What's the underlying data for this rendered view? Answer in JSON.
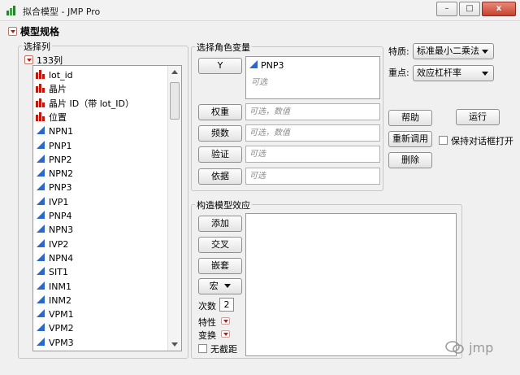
{
  "window": {
    "title": "拟合模型 - JMP Pro",
    "minimize": "–",
    "maximize": "□",
    "close": "x"
  },
  "outline": {
    "title": "模型规格"
  },
  "columns_panel": {
    "label": "选择列",
    "count_label": "133列",
    "items": [
      {
        "label": "lot_id",
        "type": "nominal"
      },
      {
        "label": "晶片",
        "type": "nominal"
      },
      {
        "label": "晶片 ID（带 lot_ID）",
        "type": "nominal"
      },
      {
        "label": "位置",
        "type": "nominal"
      },
      {
        "label": "NPN1",
        "type": "continuous"
      },
      {
        "label": "PNP1",
        "type": "continuous"
      },
      {
        "label": "PNP2",
        "type": "continuous"
      },
      {
        "label": "NPN2",
        "type": "continuous"
      },
      {
        "label": "PNP3",
        "type": "continuous"
      },
      {
        "label": "IVP1",
        "type": "continuous"
      },
      {
        "label": "PNP4",
        "type": "continuous"
      },
      {
        "label": "NPN3",
        "type": "continuous"
      },
      {
        "label": "IVP2",
        "type": "continuous"
      },
      {
        "label": "NPN4",
        "type": "continuous"
      },
      {
        "label": "SIT1",
        "type": "continuous"
      },
      {
        "label": "INM1",
        "type": "continuous"
      },
      {
        "label": "INM2",
        "type": "continuous"
      },
      {
        "label": "VPM1",
        "type": "continuous"
      },
      {
        "label": "VPM2",
        "type": "continuous"
      },
      {
        "label": "VPM3",
        "type": "continuous"
      }
    ]
  },
  "roles_panel": {
    "label": "选择角色变量",
    "y_button": "Y",
    "y_value": "PNP3",
    "y_placeholder": "可选",
    "weight_button": "权重",
    "weight_placeholder": "可选，数值",
    "freq_button": "频数",
    "freq_placeholder": "可选，数值",
    "validation_button": "验证",
    "validation_placeholder": "可选",
    "by_button": "依据",
    "by_placeholder": "可选"
  },
  "effects_panel": {
    "label": "构造模型效应",
    "add_button": "添加",
    "cross_button": "交叉",
    "nest_button": "嵌套",
    "macros_button": "宏",
    "degree_label": "次数",
    "degree_value": "2",
    "attributes_label": "特性",
    "transform_label": "变换",
    "no_intercept_label": "无截距"
  },
  "options": {
    "personality_label": "特质:",
    "personality_value": "标准最小二乘法",
    "emphasis_label": "重点:",
    "emphasis_value": "效应杠杆率",
    "help_button": "帮助",
    "run_button": "运行",
    "recall_button": "重新调用",
    "keep_open_label": "保持对话框打开",
    "remove_button": "删除"
  },
  "watermark": {
    "text": "jmp"
  }
}
